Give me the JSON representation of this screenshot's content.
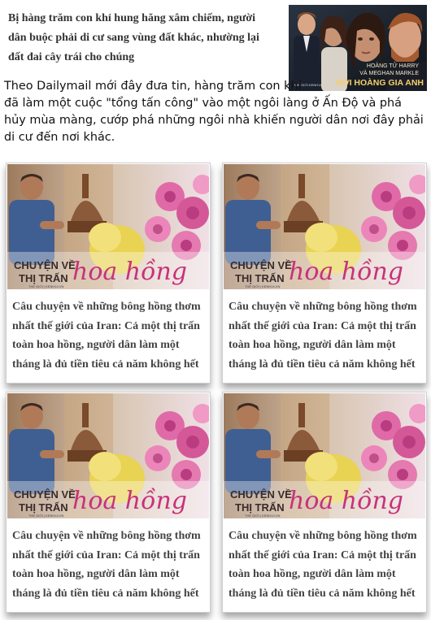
{
  "featured": {
    "caption": "Bị hàng trăm con khỉ hung hăng xâm chiếm, người dân buộc phải di cư sang vùng đất khác, nhường lại đất đai cây trái cho chúng",
    "image_alt": "Hoàng tử Harry và Meghan Markle rời hoàng gia Anh",
    "image_text_line1": "HOÀNG TỬ HARRY",
    "image_text_line2": "VÀ MEGHAN MARKLE",
    "image_text_line3": "RỜI HOÀNG GIA ANH",
    "image_badge": "THẾ GIỚI KENH14"
  },
  "article": {
    "line1": "Theo Dailymail mới đây đưa tin, hàng trăm con khỉ",
    "rest": "đã làm một cuộc \"tổng tấn công\" vào một ngôi làng ở Ấn Độ và phá hủy mùa màng, cướp phá những ngôi nhà khiến người dân nơi đây phải di cư đến nơi khác."
  },
  "cards": [
    {
      "title": "Câu chuyện về những bông hồng thơm nhất thế giới của Iran: Cả một thị trấn toàn hoa hồng, người dân làm một tháng là đủ tiền tiêu cả năm không hết",
      "img_line1": "CHUYỆN VỀ",
      "img_line2": "THỊ TRẤN",
      "img_script": "hoa hồng",
      "img_source": "THẾ GIỚI | KENH14.VN"
    },
    {
      "title": "Câu chuyện về những bông hồng thơm nhất thế giới của Iran: Cả một thị trấn toàn hoa hồng, người dân làm một tháng là đủ tiền tiêu cả năm không hết",
      "img_line1": "CHUYỆN VỀ",
      "img_line2": "THỊ TRẤN",
      "img_script": "hoa hồng",
      "img_source": "THẾ GIỚI | KENH14.VN"
    },
    {
      "title": "Câu chuyện về những bông hồng thơm nhất thế giới của Iran: Cả một thị trấn toàn hoa hồng, người dân làm một tháng là đủ tiền tiêu cả năm không hết",
      "img_line1": "CHUYỆN VỀ",
      "img_line2": "THỊ TRẤN",
      "img_script": "hoa hồng",
      "img_source": "THẾ GIỚI | KENH14.VN"
    },
    {
      "title": "Câu chuyện về những bông hồng thơm nhất thế giới của Iran: Cả một thị trấn toàn hoa hồng, người dân làm một tháng là đủ tiền tiêu cả năm không hết",
      "img_line1": "CHUYỆN VỀ",
      "img_line2": "THỊ TRẤN",
      "img_script": "hoa hồng",
      "img_source": "THẾ GIỚI | KENH14.VN"
    }
  ],
  "colors": {
    "script_pink": "#c8327a",
    "card_title": "#444444"
  }
}
